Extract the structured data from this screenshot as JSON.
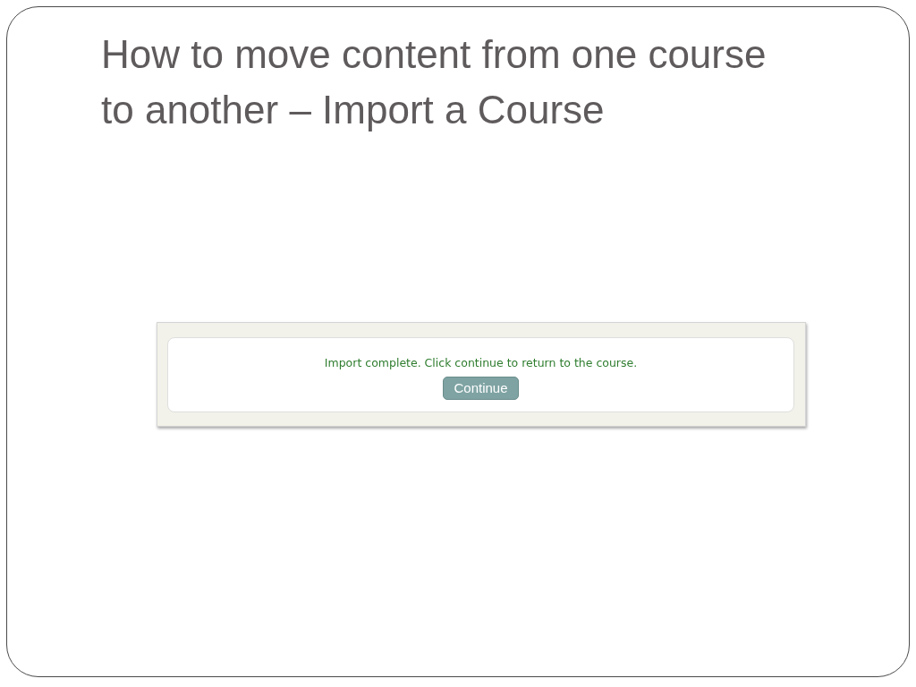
{
  "slide": {
    "title": "How to move content from one course to another – Import a Course",
    "screenshot": {
      "message": "Import complete. Click continue to return to the course.",
      "button": "Continue"
    }
  }
}
